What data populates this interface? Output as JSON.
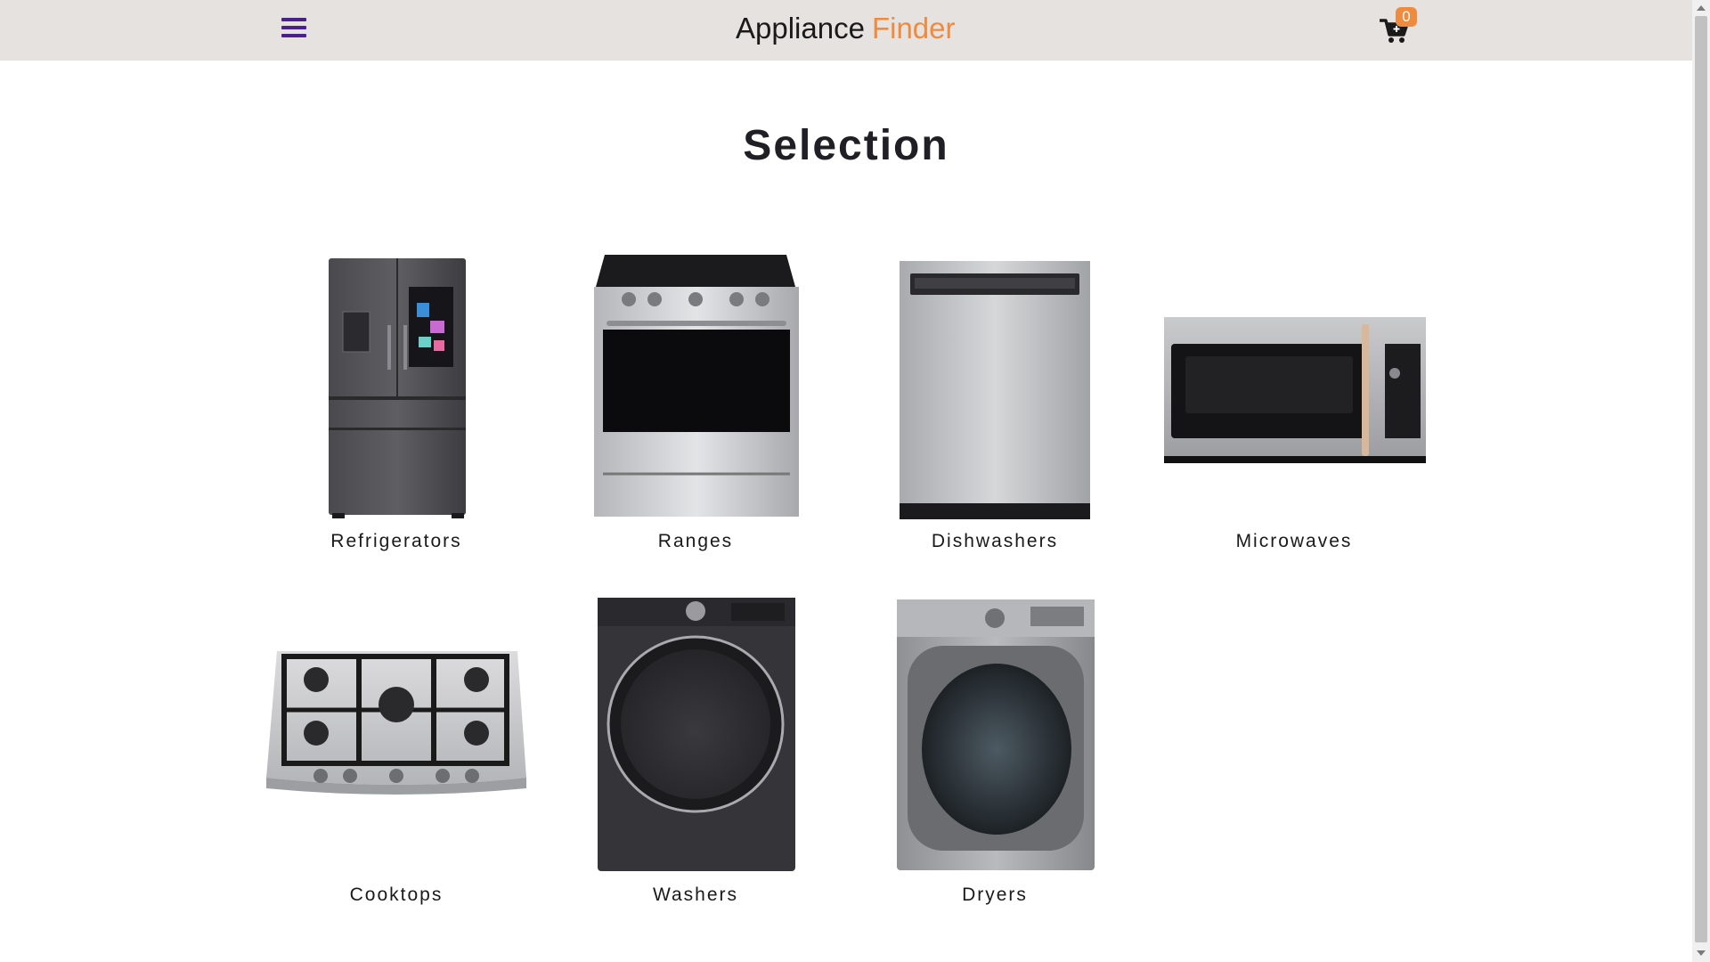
{
  "header": {
    "brand_part1": "Appliance",
    "brand_part2": "Finder",
    "cart_count": "0",
    "menu_icon": "hamburger-menu-icon",
    "cart_icon": "shopping-cart-icon"
  },
  "colors": {
    "header_bg": "#e6e2df",
    "accent_orange": "#ef8b3f",
    "menu_purple": "#4b1f8c"
  },
  "main": {
    "title": "Selection",
    "categories": [
      {
        "label": "Refrigerators",
        "icon": "refrigerator-image"
      },
      {
        "label": "Ranges",
        "icon": "range-image"
      },
      {
        "label": "Dishwashers",
        "icon": "dishwasher-image"
      },
      {
        "label": "Microwaves",
        "icon": "microwave-image"
      },
      {
        "label": "Cooktops",
        "icon": "cooktop-image"
      },
      {
        "label": "Washers",
        "icon": "washer-image"
      },
      {
        "label": "Dryers",
        "icon": "dryer-image"
      }
    ]
  }
}
